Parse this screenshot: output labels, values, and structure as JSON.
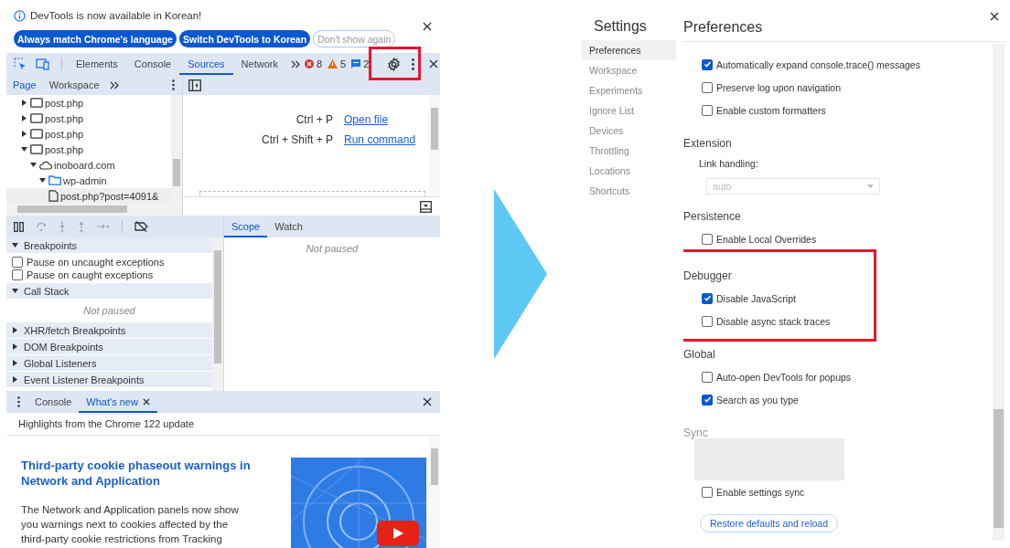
{
  "devtools": {
    "notice": {
      "text": "DevTools is now available in Korean!",
      "buttons": [
        {
          "label": "Always match Chrome's language",
          "kind": "primary"
        },
        {
          "label": "Switch DevTools to Korean",
          "kind": "primary"
        },
        {
          "label": "Don't show again",
          "kind": "outline"
        }
      ]
    },
    "tabs": [
      {
        "label": "Elements",
        "selected": false
      },
      {
        "label": "Console",
        "selected": false
      },
      {
        "label": "Sources",
        "selected": true
      },
      {
        "label": "Network",
        "selected": false
      }
    ],
    "counters": [
      {
        "kind": "error",
        "count": "8"
      },
      {
        "kind": "warning",
        "count": "5"
      },
      {
        "kind": "info",
        "count": "2"
      }
    ],
    "settings_highlighted": true,
    "navigator_tabs": [
      {
        "label": "Page",
        "selected": true
      },
      {
        "label": "Workspace",
        "selected": false
      }
    ],
    "tree": [
      {
        "kind": "frame",
        "label": "post.php",
        "expanded": false
      },
      {
        "kind": "frame",
        "label": "post.php",
        "expanded": false
      },
      {
        "kind": "frame",
        "label": "post.php",
        "expanded": false
      },
      {
        "kind": "frame",
        "label": "post.php",
        "expanded": true,
        "children": [
          {
            "kind": "domain",
            "label": "inoboard.com",
            "expanded": true,
            "children": [
              {
                "kind": "folder",
                "label": "wp-admin",
                "expanded": true,
                "children": [
                  {
                    "kind": "file",
                    "label": "post.php?post=4091&",
                    "selected": true
                  }
                ]
              }
            ]
          }
        ]
      }
    ],
    "shortcuts": [
      {
        "keys": "Ctrl + P",
        "action": "Open file"
      },
      {
        "keys": "Ctrl + Shift + P",
        "action": "Run command"
      }
    ],
    "sections": [
      {
        "title": "Breakpoints",
        "expanded": true,
        "checkboxes": [
          {
            "label": "Pause on uncaught exceptions",
            "checked": false
          },
          {
            "label": "Pause on caught exceptions",
            "checked": false
          }
        ]
      },
      {
        "title": "Call Stack",
        "expanded": true,
        "message": "Not paused"
      },
      {
        "title": "XHR/fetch Breakpoints",
        "expanded": false
      },
      {
        "title": "DOM Breakpoints",
        "expanded": false
      },
      {
        "title": "Global Listeners",
        "expanded": false
      },
      {
        "title": "Event Listener Breakpoints",
        "expanded": false
      }
    ],
    "scope_tabs": [
      {
        "label": "Scope",
        "selected": true
      },
      {
        "label": "Watch",
        "selected": false
      }
    ],
    "scope_message": "Not paused",
    "drawer_tabs": [
      {
        "label": "Console",
        "selected": false,
        "closable": false
      },
      {
        "label": "What's new",
        "selected": true,
        "closable": true
      }
    ],
    "whats_new": {
      "subtitle": "Highlights from the Chrome 122 update",
      "headline": "Third-party cookie phaseout warnings in Network and Application",
      "body": "The Network and Application panels now show you warnings next to cookies affected by the third-party cookie restrictions from Tracking"
    }
  },
  "settings": {
    "title": "Settings",
    "nav": [
      {
        "label": "Preferences",
        "selected": true
      },
      {
        "label": "Workspace",
        "selected": false
      },
      {
        "label": "Experiments",
        "selected": false
      },
      {
        "label": "Ignore List",
        "selected": false
      },
      {
        "label": "Devices",
        "selected": false
      },
      {
        "label": "Throttling",
        "selected": false
      },
      {
        "label": "Locations",
        "selected": false
      },
      {
        "label": "Shortcuts",
        "selected": false
      }
    ],
    "heading": "Preferences",
    "sections": [
      {
        "items": [
          {
            "kind": "checkbox",
            "label": "Automatically expand console.trace() messages",
            "checked": true
          },
          {
            "kind": "checkbox",
            "label": "Preserve log upon navigation",
            "checked": false
          },
          {
            "kind": "checkbox",
            "label": "Enable custom formatters",
            "checked": false
          }
        ]
      },
      {
        "title": "Extension",
        "items": [
          {
            "kind": "select",
            "label": "Link handling:",
            "value": "auto",
            "disabled": true
          }
        ]
      },
      {
        "title": "Persistence",
        "items": [
          {
            "kind": "checkbox",
            "label": "Enable Local Overrides",
            "checked": false
          }
        ]
      },
      {
        "title": "Debugger",
        "highlighted": true,
        "items": [
          {
            "kind": "checkbox",
            "label": "Disable JavaScript",
            "checked": true
          },
          {
            "kind": "checkbox",
            "label": "Disable async stack traces",
            "checked": false
          }
        ]
      },
      {
        "title": "Global",
        "items": [
          {
            "kind": "checkbox",
            "label": "Auto-open DevTools for popups",
            "checked": false
          },
          {
            "kind": "checkbox",
            "label": "Search as you type",
            "checked": true
          }
        ]
      },
      {
        "title": "Sync",
        "disabled": true,
        "items": [
          {
            "kind": "placeholder"
          },
          {
            "kind": "checkbox",
            "label": "Enable settings sync",
            "checked": false
          }
        ]
      }
    ],
    "button": "Restore defaults and reload"
  }
}
